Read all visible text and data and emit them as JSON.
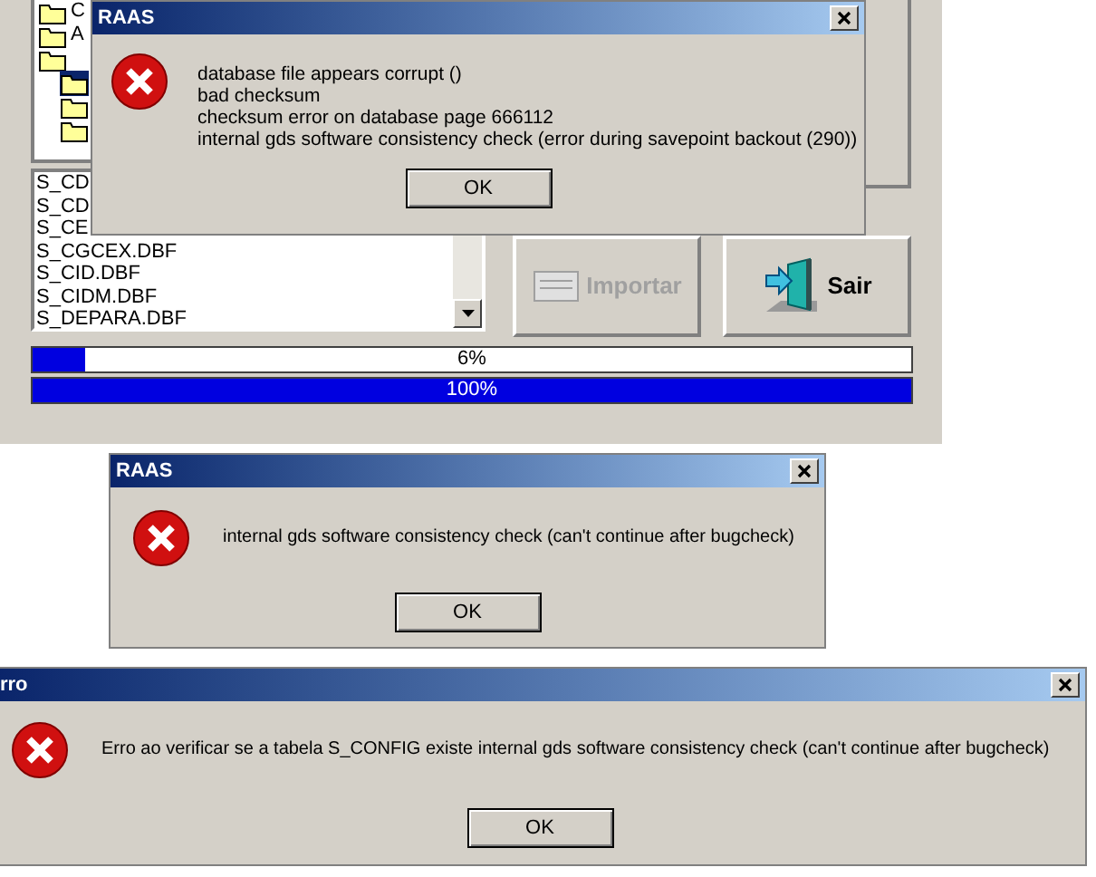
{
  "main_window": {
    "tree": {
      "items": [
        {
          "label": "C",
          "selected": false
        },
        {
          "label": "A",
          "selected": false
        },
        {
          "selected": false
        },
        {
          "selected": true
        },
        {
          "selected": false
        },
        {
          "selected": false
        }
      ]
    },
    "file_list": [
      "S_CD",
      "S_CD",
      "S_CE",
      "S_CGCEX.DBF",
      "S_CID.DBF",
      "S_CIDM.DBF",
      "S_DEPARA.DBF"
    ],
    "buttons": [
      {
        "label": "Importar",
        "disabled": true,
        "kind": "import"
      },
      {
        "label": "Sair",
        "disabled": false,
        "kind": "exit"
      }
    ],
    "progress": [
      {
        "label": "6%",
        "level": 0.06
      },
      {
        "label": "100%",
        "level": 1.0
      }
    ]
  },
  "dialogs": [
    {
      "title": "RAAS",
      "lines": [
        "database file appears corrupt ()",
        "bad checksum",
        "checksum error on database page 666112",
        "internal gds software consistency check (error during savepoint backout (290))"
      ],
      "button": "OK"
    },
    {
      "title": "RAAS",
      "lines": [
        "internal gds software consistency check (can't continue after bugcheck)"
      ],
      "button": "OK"
    },
    {
      "title": "rro",
      "lines": [
        "Erro ao verificar se a tabela S_CONFIG existe internal gds software consistency check (can't continue after bugcheck)"
      ],
      "button": "OK"
    }
  ]
}
